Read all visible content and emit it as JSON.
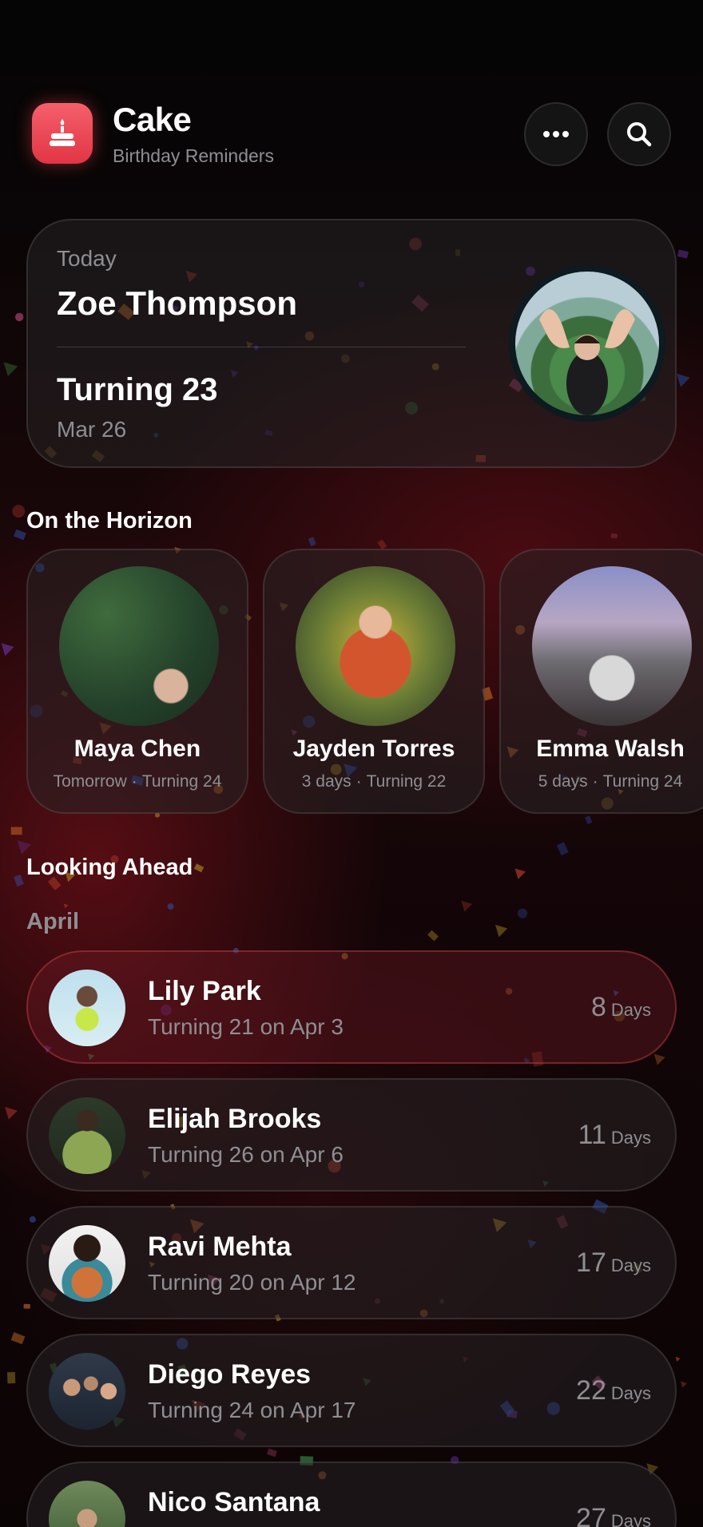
{
  "app": {
    "title": "Cake",
    "subtitle": "Birthday Reminders",
    "icon": "cake-icon",
    "accent": "#e8404e"
  },
  "toolbar": {
    "more_icon": "ellipsis-icon",
    "search_icon": "search-icon"
  },
  "today": {
    "label": "Today",
    "name": "Zoe Thompson",
    "turning": "Turning 23",
    "date": "Mar 26"
  },
  "horizon": {
    "title": "On the Horizon",
    "items": [
      {
        "name": "Maya Chen",
        "when": "Tomorrow",
        "separator": "·",
        "turning": "Turning 24"
      },
      {
        "name": "Jayden Torres",
        "when": "3 days",
        "separator": "·",
        "turning": "Turning 22"
      },
      {
        "name": "Emma Walsh",
        "when": "5 days",
        "separator": "·",
        "turning": "Turning 24"
      }
    ]
  },
  "looking_ahead": {
    "title": "Looking Ahead",
    "month": "April",
    "days_unit": "Days",
    "items": [
      {
        "name": "Lily Park",
        "detail": "Turning 21 on Apr 3",
        "days": "8"
      },
      {
        "name": "Elijah Brooks",
        "detail": "Turning 26 on Apr 6",
        "days": "11"
      },
      {
        "name": "Ravi Mehta",
        "detail": "Turning 20 on Apr 12",
        "days": "17"
      },
      {
        "name": "Diego Reyes",
        "detail": "Turning 24 on Apr 17",
        "days": "22"
      },
      {
        "name": "Nico Santana",
        "detail": "",
        "days": "27"
      }
    ]
  }
}
